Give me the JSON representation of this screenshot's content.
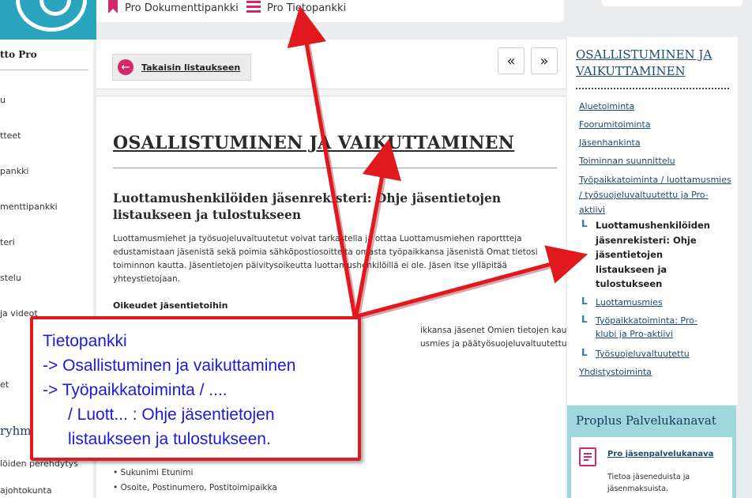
{
  "topbar": {
    "items": [
      {
        "label": "Pro Dokumenttipankki",
        "icon": "bookmark-icon"
      },
      {
        "label": "Pro Tietopankki",
        "icon": "menu-icon"
      }
    ]
  },
  "logo": {
    "name": "pro-logo"
  },
  "left_nav": {
    "title": "tto Pro",
    "items": [
      "u",
      "tteet",
      "pankki",
      "menttipankki",
      "teri",
      "stelu",
      "ja videot",
      "et"
    ],
    "group_title": "ryhm",
    "sub_items": [
      "löiden perehdytys",
      "ajohtokunta"
    ]
  },
  "main": {
    "back_label": "Takaisin listaukseen",
    "prev_label": "«",
    "next_label": "»",
    "title": "OSALLISTUMINEN JA VAIKUTTAMINEN",
    "subtitle": "Luottamushenkilöiden jäsenrekisteri: Ohje jäsentietojen listaukseen ja tulostukseen",
    "intro": "Luottamusmiehet ja työsuojeluvaltuutetut voivat tarkastella ja ottaa Luottamusmiehen raporttteja edustamistaan jäsenistä sekä poimia sähköpostiosoitteita omasta työpaikkansa jäsenistä Omat tietosi toiminnon kautta. Jäsentietojen päivitysoikeutta luottamushenkilöillä ei ole. Jäsen itse ylläpitää yhteystietojaan.",
    "rights_heading": "Oikeudet jäsentietoihin",
    "rights_line1": "ikkansa jäsenet Omien tietojen kautta",
    "rights_line2": "usmies ja päätyösuojeluvaltuutettu näkevät",
    "list_items": [
      "Sukunimi Etunimi",
      "Osoite, Postinumero, Postitoimipaikka"
    ]
  },
  "right_nav": {
    "heading": "OSALLISTUMINEN JA VAIKUTTAMINEN",
    "links": [
      "Aluetoiminta",
      "Foorumitoiminta",
      "Jäsenhankinta",
      "Toiminnan suunnittelu",
      "Työpaikkatoiminta / luottamusmies / työsuojeluvaltuutettu ja Pro-aktiivi"
    ],
    "sub_marker": "L",
    "active": "Luottamushenkilöiden jäsenrekisteri: Ohje jäsentietojen listaukseen ja tulostukseen",
    "sub_links": [
      "Luottamusmies",
      "Työpaikkatoiminta: Pro-klubi ja Pro-aktiivi",
      "Työsuojeluvaltuutettu"
    ],
    "last_link": "Yhdistystoiminta"
  },
  "service_box": {
    "heading": "Proplus Palvelukanavat",
    "link": "Pro jäsenpalvelukanava",
    "description": "Tietoa jäseneduista ja jäsenmaksuista."
  },
  "annotation": {
    "lines": [
      "Tietopankki",
      "-> Osallistuminen ja vaikuttaminen",
      "-> Työpaikkatoiminta / ....",
      "   / Luott... : Ohje jäsentietojen",
      "   listaukseen ja tulostukseen."
    ],
    "color": "#1a1ae0",
    "arrow_color": "#e1191f"
  }
}
